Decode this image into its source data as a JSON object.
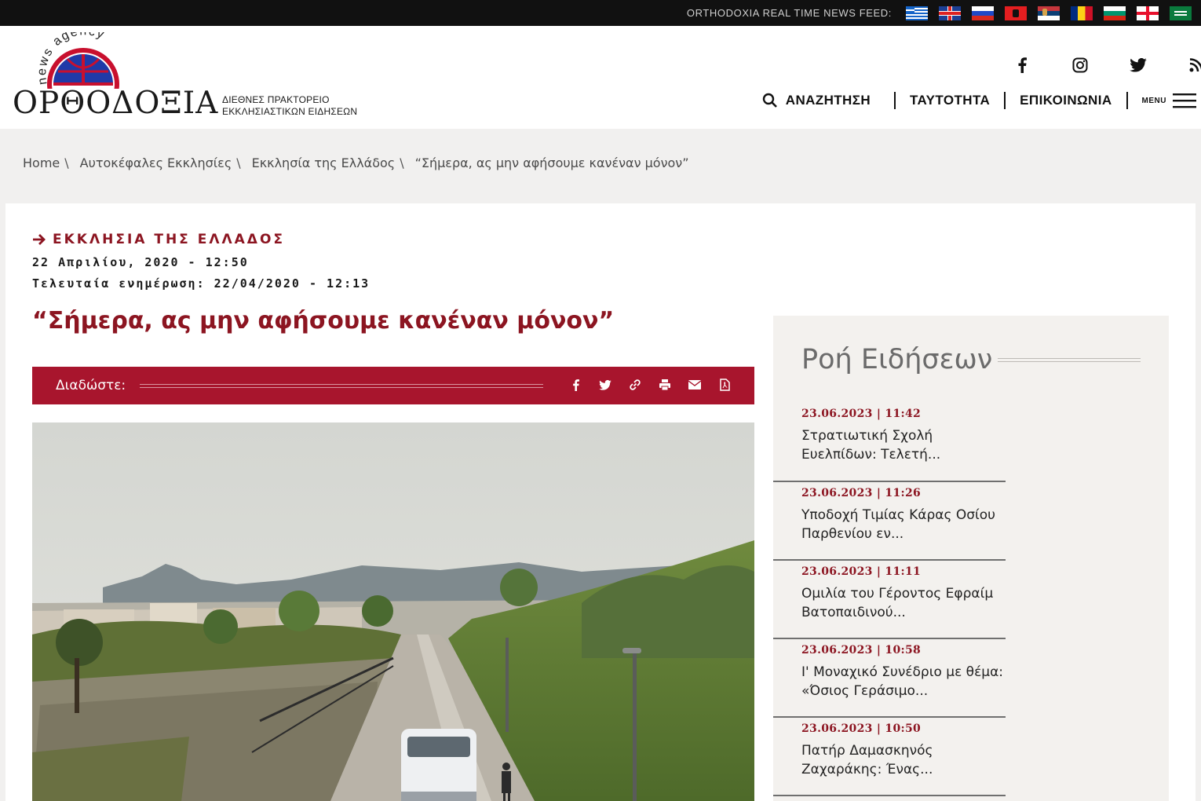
{
  "topbar": {
    "feed_label": "ORTHODOXIA REAL TIME NEWS FEED:",
    "flags": [
      "greek-flag-icon",
      "uk-flag-icon",
      "russia-flag-icon",
      "albania-flag-icon",
      "serbia-flag-icon",
      "romania-flag-icon",
      "bulgaria-flag-icon",
      "georgia-flag-icon",
      "arabic-flag-icon"
    ]
  },
  "header": {
    "logo_arc": "news agency",
    "logo_word": "ΟΡΘΟΔΟΞΙΑ",
    "logo_sub_line1": "ΔΙΕΘΝΕΣ ΠΡΑΚΤΟΡΕΙΟ",
    "logo_sub_line2": "ΕΚΚΛΗΣΙΑΣΤΙΚΩΝ ΕΙΔΗΣΕΩΝ",
    "social": [
      "facebook-icon",
      "instagram-icon",
      "twitter-icon",
      "rss-icon"
    ],
    "nav": {
      "search": "ΑΝΑΖΗΤΗΣΗ",
      "identity": "ΤΑΥΤΟΤΗΤΑ",
      "contact": "ΕΠΙΚΟΙΝΩΝΙΑ",
      "menu": "MENU"
    }
  },
  "breadcrumb": {
    "items": [
      "Home",
      "Αυτοκέφαλες Εκκλησίες",
      "Εκκλησία της Ελλάδος",
      "“Σήμερα, ας μην αφήσουμε κανέναν μόνον”"
    ],
    "separator": "\\"
  },
  "article": {
    "category": "ΕΚΚΛΗΣΙΑ ΤΗΣ ΕΛΛΑΔΟΣ",
    "date": "22 Απριλίου, 2020 - 12:50",
    "updated": "Τελευταία ενημέρωση: 22/04/2020 - 12:13",
    "title": "“Σήμερα, ας μην αφήσουμε κανέναν μόνον”",
    "share_label": "Διαδώστε:",
    "share_icons": [
      "facebook-icon",
      "twitter-icon",
      "link-icon",
      "print-icon",
      "email-icon",
      "pdf-icon"
    ]
  },
  "sidebar": {
    "title": "Ροή Ειδήσεων",
    "items": [
      {
        "time": "23.06.2023 | 11:42",
        "text": "Στρατιωτική Σχολή Ευελπίδων: Τελετή..."
      },
      {
        "time": "23.06.2023 | 11:26",
        "text": "Υποδοχή Τιμίας Κάρας Οσίου Παρθενίου εν..."
      },
      {
        "time": "23.06.2023 | 11:11",
        "text": "Ομιλία του Γέροντος Εφραίμ Βατοπαιδινού..."
      },
      {
        "time": "23.06.2023 | 10:58",
        "text": "Ι' Μοναχικό Συνέδριο με θέμα: «Όσιος Γεράσιμο..."
      },
      {
        "time": "23.06.2023 | 10:50",
        "text": "Πατήρ Δαμασκηνός Ζαχαράκης: Ένας..."
      }
    ]
  },
  "colors": {
    "brand_red": "#8c1521",
    "share_bar": "#a8152d",
    "topbar": "#111111",
    "page_bg": "#f1f0ef"
  }
}
